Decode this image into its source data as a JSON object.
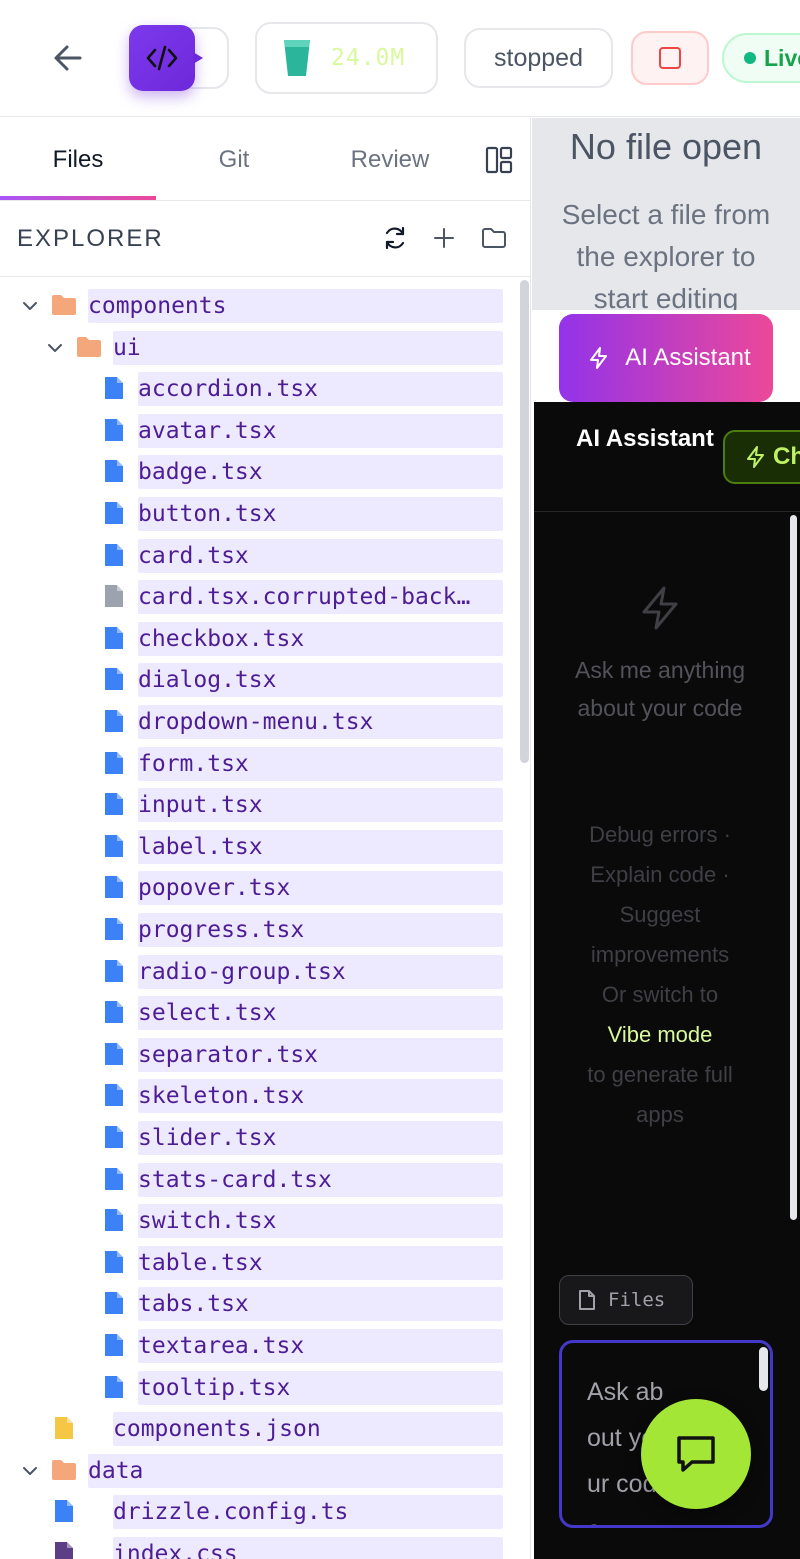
{
  "topbar": {
    "back_icon": "arrow-left-icon",
    "logo_icon": "code-icon",
    "memory_icon": "cup-icon",
    "memory_value": "24.0M",
    "status": "stopped",
    "stop_icon": "square-icon",
    "live_label": "Live"
  },
  "tabs": [
    {
      "label": "Files",
      "active": true
    },
    {
      "label": "Git",
      "active": false
    },
    {
      "label": "Review",
      "active": false
    }
  ],
  "explorer": {
    "title": "EXPLORER",
    "actions": [
      "refresh-icon",
      "plus-icon",
      "folder-icon"
    ]
  },
  "tree": [
    {
      "label": "components",
      "type": "folder",
      "expanded": true,
      "depth": 0
    },
    {
      "label": "ui",
      "type": "folder",
      "expanded": true,
      "depth": 1
    },
    {
      "label": "accordion.tsx",
      "type": "file",
      "depth": 2
    },
    {
      "label": "avatar.tsx",
      "type": "file",
      "depth": 2
    },
    {
      "label": "badge.tsx",
      "type": "file",
      "depth": 2
    },
    {
      "label": "button.tsx",
      "type": "file",
      "depth": 2
    },
    {
      "label": "card.tsx",
      "type": "file",
      "depth": 2
    },
    {
      "label": "card.tsx.corrupted-back…",
      "type": "file-generic",
      "depth": 2
    },
    {
      "label": "checkbox.tsx",
      "type": "file",
      "depth": 2
    },
    {
      "label": "dialog.tsx",
      "type": "file",
      "depth": 2
    },
    {
      "label": "dropdown-menu.tsx",
      "type": "file",
      "depth": 2
    },
    {
      "label": "form.tsx",
      "type": "file",
      "depth": 2
    },
    {
      "label": "input.tsx",
      "type": "file",
      "depth": 2
    },
    {
      "label": "label.tsx",
      "type": "file",
      "depth": 2
    },
    {
      "label": "popover.tsx",
      "type": "file",
      "depth": 2
    },
    {
      "label": "progress.tsx",
      "type": "file",
      "depth": 2
    },
    {
      "label": "radio-group.tsx",
      "type": "file",
      "depth": 2
    },
    {
      "label": "select.tsx",
      "type": "file",
      "depth": 2
    },
    {
      "label": "separator.tsx",
      "type": "file",
      "depth": 2
    },
    {
      "label": "skeleton.tsx",
      "type": "file",
      "depth": 2
    },
    {
      "label": "slider.tsx",
      "type": "file",
      "depth": 2
    },
    {
      "label": "stats-card.tsx",
      "type": "file",
      "depth": 2
    },
    {
      "label": "switch.tsx",
      "type": "file",
      "depth": 2
    },
    {
      "label": "table.tsx",
      "type": "file",
      "depth": 2
    },
    {
      "label": "tabs.tsx",
      "type": "file",
      "depth": 2
    },
    {
      "label": "textarea.tsx",
      "type": "file",
      "depth": 2
    },
    {
      "label": "tooltip.tsx",
      "type": "file",
      "depth": 2
    },
    {
      "label": "components.json",
      "type": "file-json",
      "depth": 1
    },
    {
      "label": "data",
      "type": "folder",
      "expanded": true,
      "depth": 0
    },
    {
      "label": "drizzle.config.ts",
      "type": "file",
      "depth": 1
    },
    {
      "label": "index.css",
      "type": "file-css",
      "depth": 1
    }
  ],
  "editor": {
    "empty_title": "No file open",
    "empty_subtitle": "Select a file from the explorer to start editing",
    "ai_button": "AI Assistant"
  },
  "assistant": {
    "title": "AI Assistant",
    "mode_label": "Chat",
    "empty_main": "Ask me anything about your code",
    "empty_sub_line1": "Debug errors · Explain code · Suggest improvements",
    "empty_sub_line2": "Or switch to",
    "vibe_mode": "Vibe mode",
    "empty_sub_line3": "to generate full apps",
    "files_chip": "Files",
    "input_placeholder": "Ask about your code..."
  },
  "colors": {
    "accent": "#7c3aed",
    "tree_highlight": "#ede9fe",
    "tree_text": "#4c1d95",
    "file_icon": "#3b82f6",
    "folder_icon": "#f4a77a",
    "lime": "#a3e635"
  }
}
